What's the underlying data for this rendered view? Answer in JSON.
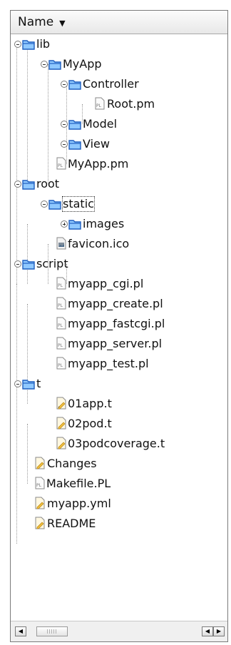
{
  "header": {
    "title": "Name",
    "sort_icon": "chevron-down-icon"
  },
  "tree": {
    "items": [
      {
        "label": "lib",
        "icon": "folder-icon",
        "expander": "collapse"
      },
      {
        "label": "MyApp",
        "icon": "folder-icon",
        "expander": "collapse"
      },
      {
        "label": "Controller",
        "icon": "folder-icon",
        "expander": "collapse"
      },
      {
        "label": "Root.pm",
        "icon": "perl-file-icon"
      },
      {
        "label": "Model",
        "icon": "folder-icon",
        "expander": "collapse"
      },
      {
        "label": "View",
        "icon": "folder-icon",
        "expander": "collapse"
      },
      {
        "label": "MyApp.pm",
        "icon": "perl-file-icon"
      },
      {
        "label": "root",
        "icon": "folder-icon",
        "expander": "collapse"
      },
      {
        "label": "static",
        "icon": "folder-icon",
        "expander": "collapse",
        "selected": true
      },
      {
        "label": "images",
        "icon": "folder-icon",
        "expander": "expand"
      },
      {
        "label": "favicon.ico",
        "icon": "image-file-icon"
      },
      {
        "label": "script",
        "icon": "folder-icon",
        "expander": "collapse"
      },
      {
        "label": "myapp_cgi.pl",
        "icon": "perl-file-icon"
      },
      {
        "label": "myapp_create.pl",
        "icon": "perl-file-icon"
      },
      {
        "label": "myapp_fastcgi.pl",
        "icon": "perl-file-icon"
      },
      {
        "label": "myapp_server.pl",
        "icon": "perl-file-icon"
      },
      {
        "label": "myapp_test.pl",
        "icon": "perl-file-icon"
      },
      {
        "label": "t",
        "icon": "folder-icon",
        "expander": "collapse"
      },
      {
        "label": "01app.t",
        "icon": "text-file-icon"
      },
      {
        "label": "02pod.t",
        "icon": "text-file-icon"
      },
      {
        "label": "03podcoverage.t",
        "icon": "text-file-icon"
      },
      {
        "label": "Changes",
        "icon": "text-file-icon"
      },
      {
        "label": "Makefile.PL",
        "icon": "perl-file-icon"
      },
      {
        "label": "myapp.yml",
        "icon": "text-file-icon"
      },
      {
        "label": "README",
        "icon": "text-file-icon"
      }
    ]
  },
  "scrollbar": {
    "left_arrow": "◀",
    "right_arrow": "▶",
    "left_btn2": "◀"
  }
}
